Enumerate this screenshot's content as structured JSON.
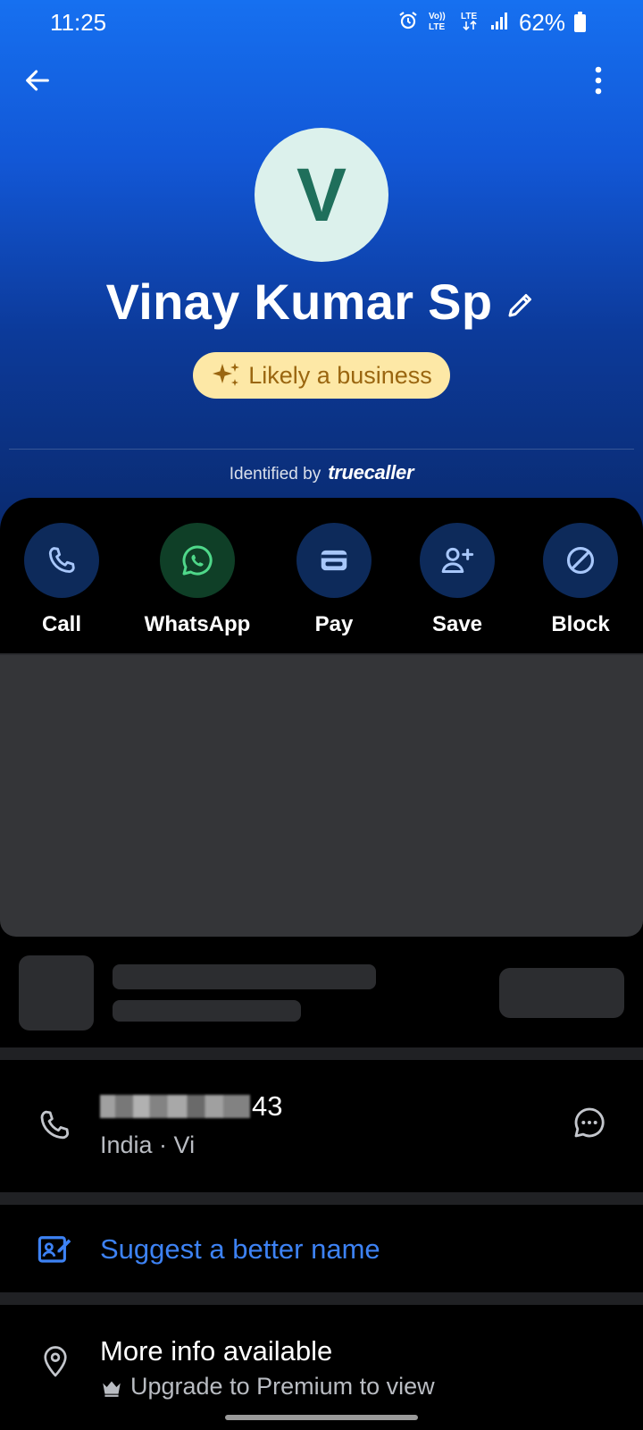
{
  "status_bar": {
    "time": "11:25",
    "battery": "62%",
    "icons": [
      "alarm-icon",
      "volte-icon",
      "lte-icon",
      "signal-icon",
      "battery-icon"
    ]
  },
  "header": {
    "back_icon": "arrow-left-icon",
    "menu_icon": "more-vert-icon"
  },
  "contact": {
    "avatar_letter": "V",
    "name": "Vinay Kumar Sp",
    "badge": "Likely a business",
    "identified_prefix": "Identified by",
    "identified_brand": "truecaller"
  },
  "actions": [
    {
      "label": "Call",
      "icon": "phone-icon"
    },
    {
      "label": "WhatsApp",
      "icon": "whatsapp-icon"
    },
    {
      "label": "Pay",
      "icon": "wallet-icon"
    },
    {
      "label": "Save",
      "icon": "add-contact-icon"
    },
    {
      "label": "Block",
      "icon": "block-icon"
    }
  ],
  "phone": {
    "number_visible_suffix": "43",
    "details": "India · Vi"
  },
  "suggest": {
    "label": "Suggest a better name"
  },
  "more_info": {
    "title": "More info available",
    "subtitle": "Upgrade to Premium to view"
  },
  "colors": {
    "accent_blue": "#3d82f4",
    "badge_bg": "#fde8a6",
    "badge_text": "#9a6610",
    "avatar_bg": "#dcf1ec",
    "avatar_text": "#1f6f5b"
  }
}
